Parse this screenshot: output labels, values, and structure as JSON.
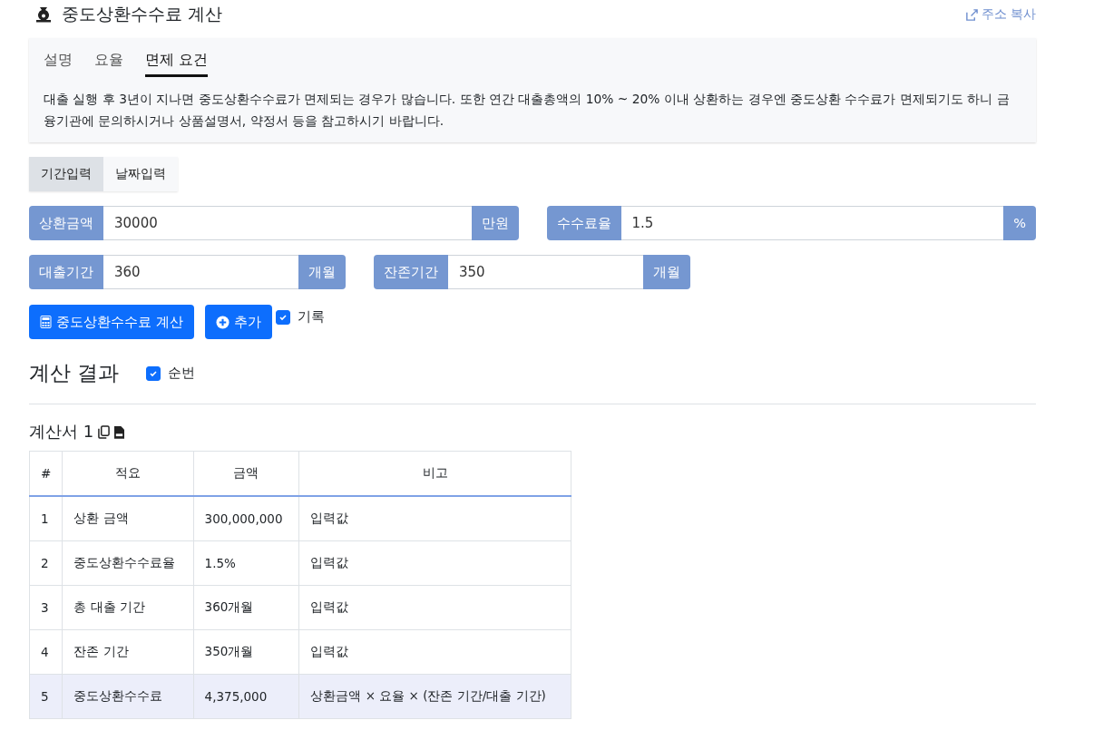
{
  "header": {
    "title": "중도상환수수료 계산",
    "copy_link": "주소 복사"
  },
  "info_tabs": [
    {
      "label": "설명",
      "selected": false
    },
    {
      "label": "요율",
      "selected": false
    },
    {
      "label": "면제 요건",
      "selected": true
    }
  ],
  "info_text": "대출 실행 후 3년이 지나면 중도상환수수료가 면제되는 경우가 많습니다. 또한 연간 대출총액의 10% ~ 20% 이내 상환하는 경우엔 중도상환 수수료가 면제되기도 하니 금융기관에 문의하시거나 상품설명서, 약정서 등을 참고하시기 바랍니다.",
  "input_modes": [
    {
      "label": "기간입력",
      "selected": true
    },
    {
      "label": "날짜입력",
      "selected": false
    }
  ],
  "field_rows": [
    [
      {
        "label": "상환금액",
        "value": "30000",
        "unit": "만원"
      },
      {
        "label": "수수료율",
        "value": "1.5",
        "unit": "%"
      }
    ],
    [
      {
        "label": "대출기간",
        "value": "360",
        "unit": "개월"
      },
      {
        "label": "잔존기간",
        "value": "350",
        "unit": "개월"
      }
    ]
  ],
  "calc_button": "중도상환수수료 계산",
  "add_button": "추가",
  "record": {
    "label": "기록",
    "checked": true
  },
  "result": {
    "title": "계산 결과",
    "numbering": {
      "label": "순번",
      "checked": true
    }
  },
  "statement": {
    "title": "계산서 1",
    "columns": [
      "#",
      "적요",
      "금액",
      "비고"
    ],
    "rows": [
      {
        "cells": [
          "1",
          "상환 금액",
          "300,000,000",
          "입력값"
        ],
        "highlighted": false
      },
      {
        "cells": [
          "2",
          "중도상환수수료율",
          "1.5%",
          "입력값"
        ],
        "highlighted": false
      },
      {
        "cells": [
          "3",
          "총 대출 기간",
          "360개월",
          "입력값"
        ],
        "highlighted": false
      },
      {
        "cells": [
          "4",
          "잔존 기간",
          "350개월",
          "입력값"
        ],
        "highlighted": false
      },
      {
        "cells": [
          "5",
          "중도상환수수료",
          "4,375,000",
          "상환금액 × 요율 × (잔존 기간/대출 기간)"
        ],
        "highlighted": true
      }
    ]
  }
}
